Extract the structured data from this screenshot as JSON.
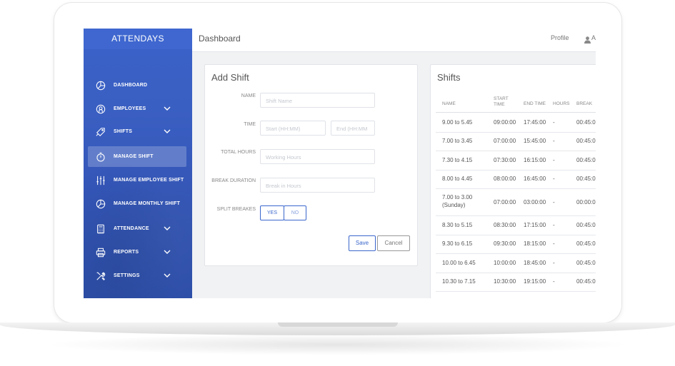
{
  "sidebar": {
    "brand": "ATTENDAYS",
    "items": [
      {
        "label": "DASHBOARD",
        "icon": "pie-chart-icon",
        "has_chevron": false
      },
      {
        "label": "EMPLOYEES",
        "icon": "employees-icon",
        "has_chevron": true
      },
      {
        "label": "SHIFTS",
        "icon": "tag-icon",
        "has_chevron": true
      },
      {
        "label": "MANAGE SHIFT",
        "icon": "timer-icon",
        "has_chevron": false,
        "active": true
      },
      {
        "label": "MANAGE EMPLOYEE SHIFT",
        "icon": "sliders-icon",
        "has_chevron": false
      },
      {
        "label": "MANAGE MONTHLY SHIFT",
        "icon": "pie-chart-icon",
        "has_chevron": false
      },
      {
        "label": "ATTENDANCE",
        "icon": "calculator-icon",
        "has_chevron": true
      },
      {
        "label": "REPORTS",
        "icon": "printer-icon",
        "has_chevron": true
      },
      {
        "label": "SETTINGS",
        "icon": "tools-icon",
        "has_chevron": true
      }
    ]
  },
  "topbar": {
    "title": "Dashboard",
    "profile": "Profile",
    "user_initial": "A"
  },
  "add_shift": {
    "title": "Add Shift",
    "name_label": "NAME",
    "name_placeholder": "Shift Name",
    "time_label": "TIME",
    "start_placeholder": "Start (HH:MM)",
    "end_placeholder": "End (HH:MM",
    "hours_label": "TOTAL HOURS",
    "hours_placeholder": "Working Hours",
    "break_label": "BREAK DURATION",
    "break_placeholder": "Break in Hours",
    "split_label": "SPLIT BREAKES",
    "yes": "YES",
    "no": "NO",
    "split_selected": "YES",
    "save": "Save",
    "cancel": "Cancel"
  },
  "shifts": {
    "title": "Shifts",
    "columns": [
      "NAME",
      "START TIME",
      "END TIME",
      "HOURS",
      "BREAK"
    ],
    "rows": [
      {
        "name": "9.00 to 5.45",
        "start": "09:00:00",
        "end": "17:45:00",
        "hours": "-",
        "break": "00:45:0"
      },
      {
        "name": "7.00 to 3.45",
        "start": "07:00:00",
        "end": "15:45:00",
        "hours": "-",
        "break": "00:45:0"
      },
      {
        "name": "7.30 to 4.15",
        "start": "07:30:00",
        "end": "16:15:00",
        "hours": "-",
        "break": "00:45:0"
      },
      {
        "name": "8.00 to 4.45",
        "start": "08:00:00",
        "end": "16:45:00",
        "hours": "-",
        "break": "00:45:0"
      },
      {
        "name": "7.00 to 3.00 (Sunday)",
        "start": "07:00:00",
        "end": "03:00:00",
        "hours": "-",
        "break": "00:00:0"
      },
      {
        "name": "8.30 to 5.15",
        "start": "08:30:00",
        "end": "17:15:00",
        "hours": "-",
        "break": "00:45:0"
      },
      {
        "name": "9.30 to 6.15",
        "start": "09:30:00",
        "end": "18:15:00",
        "hours": "-",
        "break": "00:45:0"
      },
      {
        "name": "10.00 to 6.45",
        "start": "10:00:00",
        "end": "18:45:00",
        "hours": "-",
        "break": "00:45:0"
      },
      {
        "name": "10.30 to 7.15",
        "start": "10:30:00",
        "end": "19:15:00",
        "hours": "-",
        "break": "00:45:0"
      }
    ]
  },
  "colors": {
    "sidebar": "#3a5fc2",
    "accent": "#3b67cc"
  }
}
